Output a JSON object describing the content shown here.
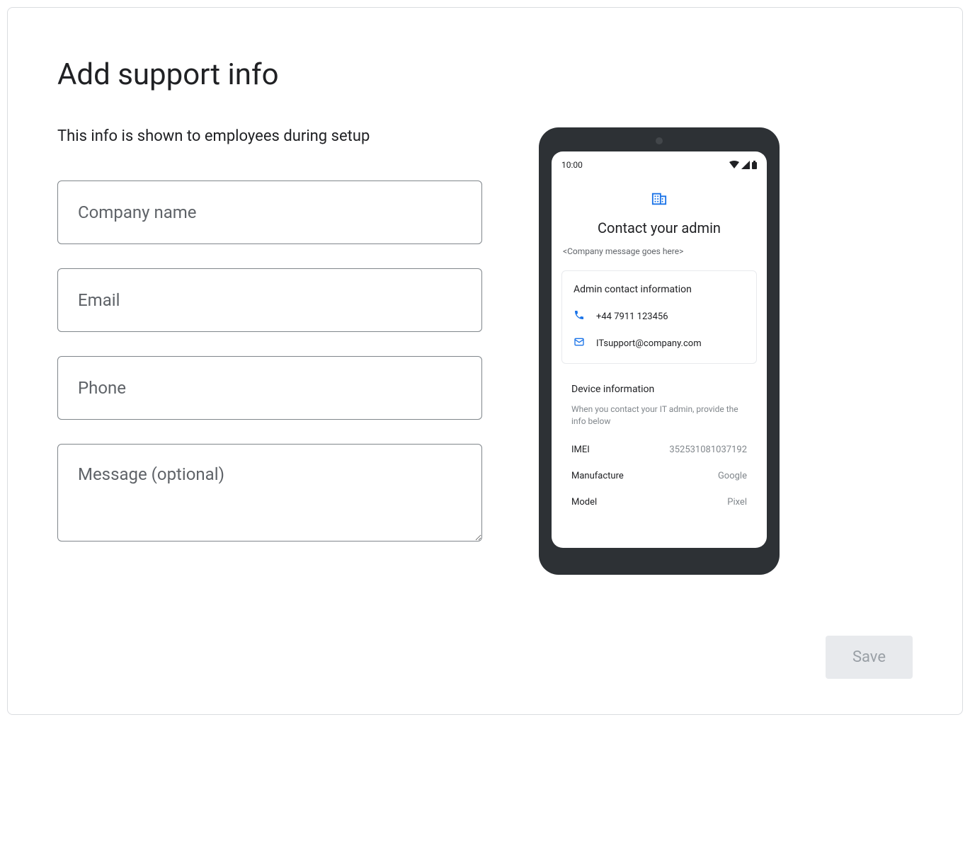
{
  "page": {
    "title": "Add support info",
    "subtitle": "This info is shown to employees during setup"
  },
  "form": {
    "company_placeholder": "Company name",
    "email_placeholder": "Email",
    "phone_placeholder": "Phone",
    "message_placeholder": "Message (optional)"
  },
  "preview": {
    "status_time": "10:00",
    "heading": "Contact your admin",
    "company_message": "<Company message goes here>",
    "admin_card_title": "Admin contact information",
    "phone_value": "+44 7911 123456",
    "email_value": "ITsupport@company.com",
    "device_info_title": "Device information",
    "device_info_subtitle": "When you contact your IT admin, provide the info below",
    "device_rows": {
      "imei_label": "IMEI",
      "imei_value": "352531081037192",
      "manufacture_label": "Manufacture",
      "manufacture_value": "Google",
      "model_label": "Model",
      "model_value": "Pixel"
    }
  },
  "actions": {
    "save_label": "Save"
  }
}
